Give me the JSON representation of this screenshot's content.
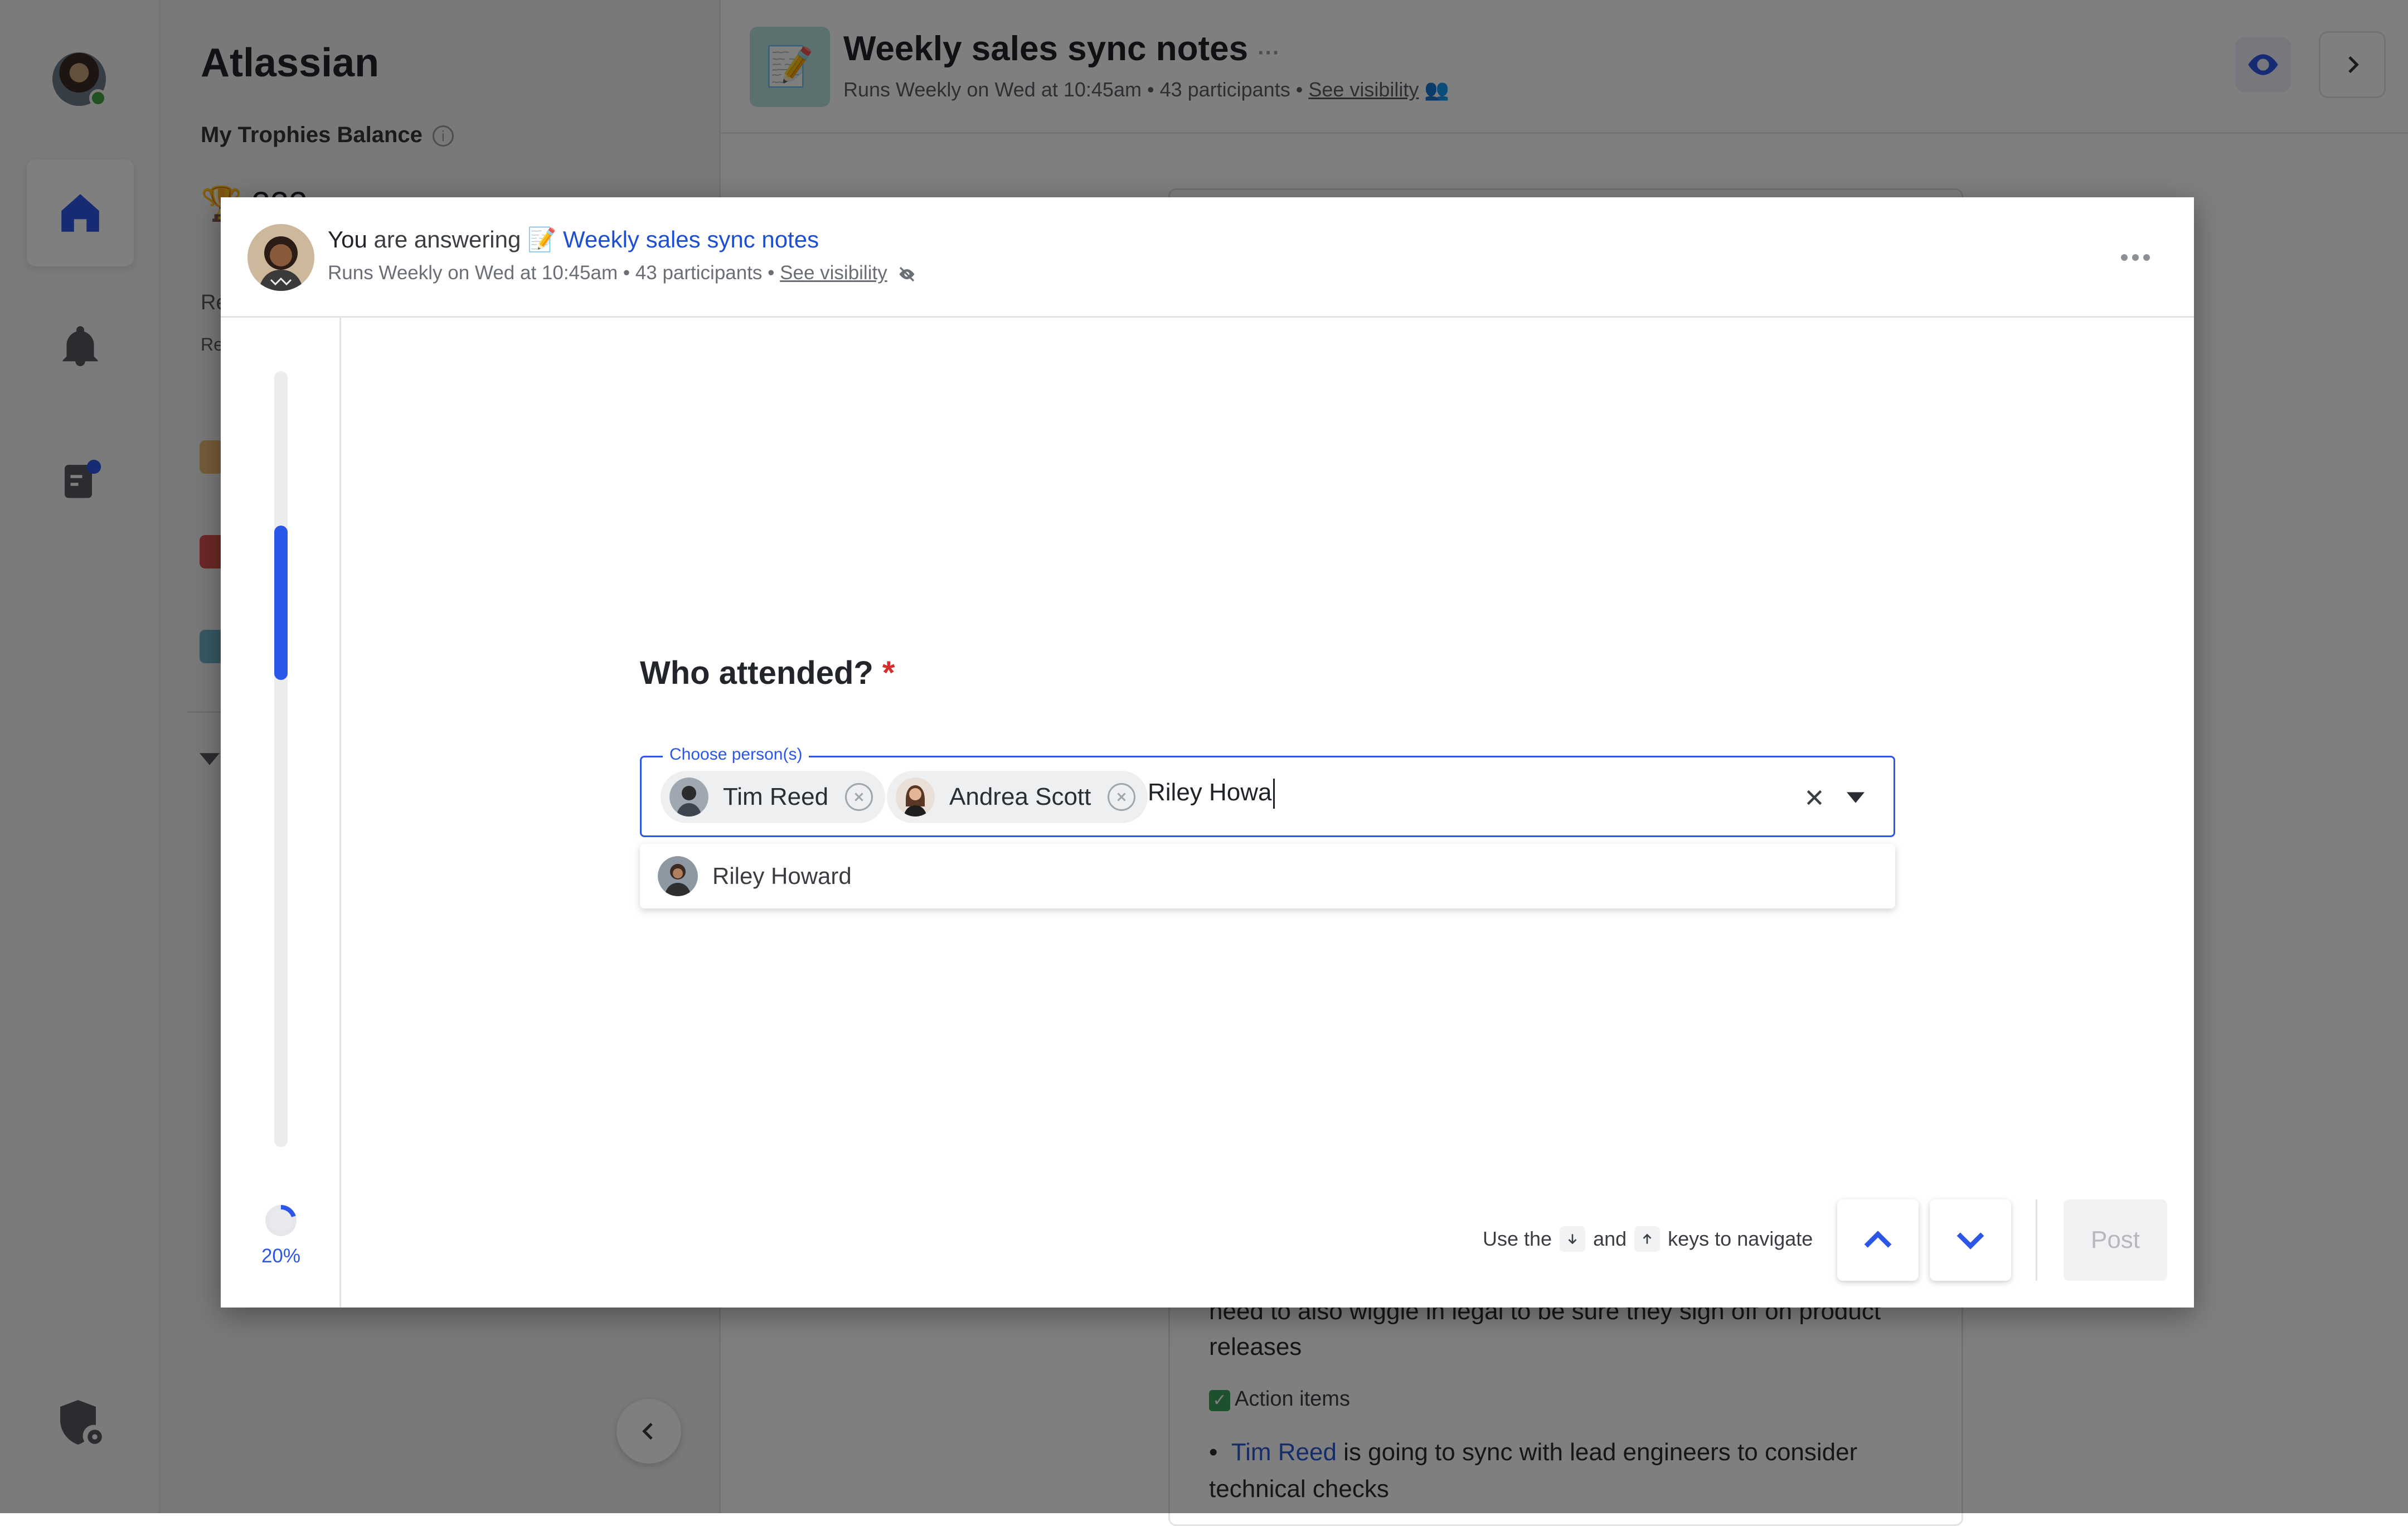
{
  "app": {
    "org_name": "Atlassian",
    "trophies_label": "My Trophies Balance",
    "trophies_value": "🏆 222",
    "sidebar_stub_1": "Re",
    "sidebar_stub_2": "Re"
  },
  "header": {
    "title": "Weekly sales sync notes",
    "title_more": "···",
    "subtitle": "Runs Weekly on Wed at 10:45am • 43 participants • ",
    "see_visibility": "See visibility"
  },
  "doc": {
    "paragraph_end": "need to also wiggle in legal to be sure they sign off on product releases",
    "action_items": "Action items",
    "mention": "Tim Reed",
    "bullet_rest": " is going to sync with lead engineers to consider technical checks"
  },
  "modal": {
    "you": "You",
    "answering": " are answering ",
    "survey_emoji": "📝",
    "survey_title": "Weekly sales sync notes",
    "meta": "Runs Weekly on Wed at 10:45am • 43 participants • ",
    "see_visibility": "See visibility",
    "progress_percent": "20%",
    "progress_value": 0.2,
    "question": "Who attended?",
    "required_mark": "*",
    "field_label": "Choose person(s)",
    "chips": [
      "Tim Reed",
      "Andrea Scott"
    ],
    "typed_value": "Riley Howa",
    "options": [
      "Riley Howard"
    ],
    "hint_pre": "Use the",
    "hint_and": "and",
    "hint_post": "keys to navigate",
    "post_label": "Post"
  },
  "colors": {
    "accent": "#2c56e8",
    "link": "#1f4fd1",
    "required": "#d32f2f",
    "online": "#43a047"
  }
}
